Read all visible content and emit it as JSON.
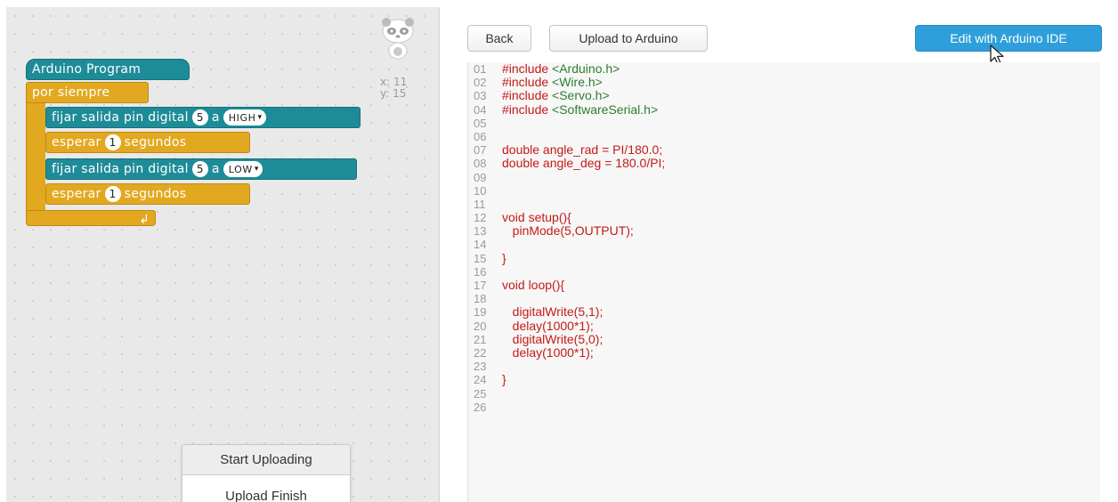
{
  "blocks": {
    "program_label": "Arduino Program",
    "forever_label": "por siempre",
    "statements": [
      {
        "text": "fijar salida pin digital",
        "pin": "5",
        "conj": "a",
        "value": "HIGH"
      },
      {
        "text": "esperar",
        "amount": "1",
        "unit": "segundos"
      },
      {
        "text": "fijar salida pin digital",
        "pin": "5",
        "conj": "a",
        "value": "LOW"
      },
      {
        "text": "esperar",
        "amount": "1",
        "unit": "segundos"
      }
    ],
    "return_icon": "↲",
    "colors": {
      "teal": "#1e8c98",
      "gold": "#e2a820"
    }
  },
  "canvas": {
    "mascot_icon": "panda-icon",
    "coord_x": "x: 11",
    "coord_y": "y: 15"
  },
  "upload_status": {
    "header": "Start Uploading",
    "finish": "Upload Finish"
  },
  "toolbar": {
    "back": "Back",
    "upload": "Upload to Arduino",
    "edit": "Edit with Arduino IDE",
    "edit_color": "#2e9fdb"
  },
  "code": {
    "line_numbers": [
      "01",
      "02",
      "03",
      "04",
      "05",
      "06",
      "07",
      "08",
      "09",
      "10",
      "11",
      "12",
      "13",
      "14",
      "15",
      "16",
      "17",
      "18",
      "19",
      "20",
      "21",
      "22",
      "23",
      "24",
      "25",
      "26"
    ],
    "l01_kw": "#include",
    "l01_arg": "<Arduino.h>",
    "l02_kw": "#include",
    "l02_arg": "<Wire.h>",
    "l03_kw": "#include",
    "l03_arg": "<Servo.h>",
    "l04_kw": "#include",
    "l04_arg": "<SoftwareSerial.h>",
    "l07": "double angle_rad = PI/180.0;",
    "l08": "double angle_deg = 180.0/PI;",
    "l12": "void setup(){",
    "l13": "   pinMode(5,OUTPUT);",
    "l15": "}",
    "l17": "void loop(){",
    "l19": "   digitalWrite(5,1);",
    "l20": "   delay(1000*1);",
    "l21": "   digitalWrite(5,0);",
    "l22": "   delay(1000*1);",
    "l24": "}"
  }
}
